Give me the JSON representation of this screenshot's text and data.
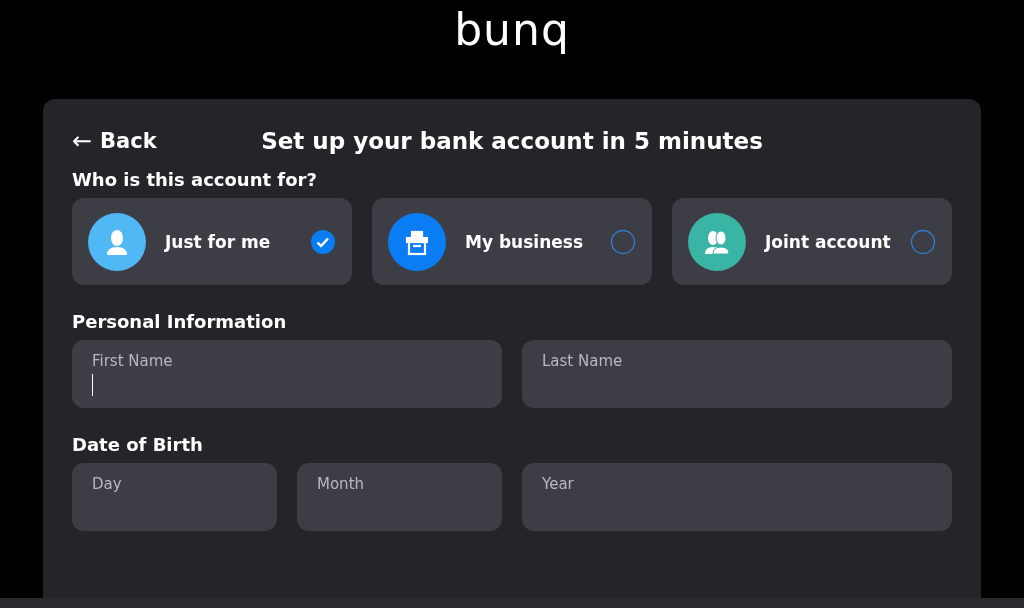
{
  "logo": "bunq",
  "back": {
    "icon": "←",
    "label": "Back"
  },
  "title": "Set up your bank account in 5 minutes",
  "account_question": "Who is this account for?",
  "options": [
    {
      "label": "Just for me",
      "kind": "person",
      "color": "#4fb8f5",
      "selected": true
    },
    {
      "label": "My business",
      "kind": "shop",
      "color": "#0a7df5",
      "selected": false
    },
    {
      "label": "Joint account",
      "kind": "pair",
      "color": "#3ab5a5",
      "selected": false
    }
  ],
  "sections": [
    {
      "heading": "Personal Information",
      "fields": [
        {
          "placeholder": "First Name",
          "focused": true
        },
        {
          "placeholder": "Last Name",
          "focused": false
        }
      ]
    },
    {
      "heading": "Date of Birth",
      "fields": [
        {
          "placeholder": "Day",
          "focused": false
        },
        {
          "placeholder": "Month",
          "focused": false
        },
        {
          "placeholder": "Year",
          "focused": false
        }
      ]
    }
  ]
}
